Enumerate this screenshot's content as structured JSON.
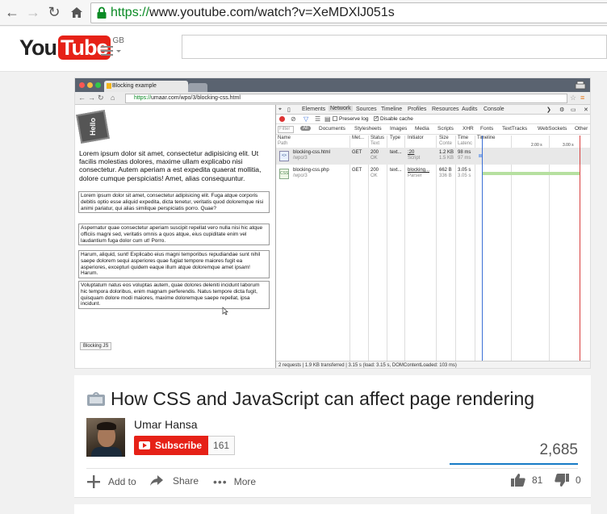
{
  "browser": {
    "url_https": "https://",
    "url_rest": "www.youtube.com/watch?v=XeMDXlJ051s"
  },
  "youtube": {
    "logo_you": "You",
    "logo_tube": "Tube",
    "logo_region": "GB"
  },
  "player": {
    "inner_tab_title": "Blocking example",
    "inner_url_https": "https://",
    "inner_url_rest": "umaar.com/wpo/3/blocking-css.html",
    "hello": "Hello",
    "big_paragraph": "Lorem ipsum dolor sit amet, consectetur adipisicing elit. Ut facilis molestias dolores, maxime ullam explicabo nisi consectetur. Autem aperiam a est expedita quaerat mollitia, dolore cumque perspiciatis! Amet, alias consequuntur.",
    "boxes": [
      "Lorem ipsum dolor sit amet, consectetur adipisicing elit. Fuga atque corporis debitis optio esse aliquid expedita, dicta tenetur, veritatis quod doloremque nisi animi pariatur, qui alias similique perspiciatis porro. Quae?",
      "Aspernatur quae consectetur aperiam suscipit repellat vero nulla nisi hic atque officiis magni sed, veritatis omnis a quos atque, eius cupiditate enim vel laudantium fuga dolor cum ut! Porro.",
      "Harum, aliquid, sunt! Explicabo eius magni temporibus repudiandae sunt nihil saepe dolorem sequi asperiores quae fugiat tempore maiores fugit ea asperiores, excepturi quidem eaque illum atque doloremque amet ipsam! Harum.",
      "Voluptatum natus eos voluptas autem, quae dolores deleniti incidunt laborum hic tempora doloribus, enim magnam perferendis. Natus tempore dicta fugit, quisquam dolore modi maiores, maxime doloremque saepe repellat, ipsa incidunt."
    ],
    "blocking_button": "Blocking JS",
    "devtools": {
      "tabs": [
        "Elements",
        "Network",
        "Sources",
        "Timeline",
        "Profiles",
        "Resources",
        "Audits",
        "Console"
      ],
      "preserve_log": "Preserve log",
      "disable_cache": "Disable cache",
      "filter_placeholder": "Filter",
      "filter_all": "All",
      "filter_types": [
        "Documents",
        "Stylesheets",
        "Images",
        "Media",
        "Scripts",
        "XHR",
        "Fonts",
        "TextTracks",
        "WebSockets",
        "Other"
      ],
      "headers": {
        "name": "Name",
        "name_sub": "Path",
        "method": "Met...",
        "status": "Status",
        "status_sub": "Text",
        "type": "Type",
        "initiator": "Initiator",
        "size": "Size",
        "size_sub": "Conte",
        "time": "Time",
        "time_sub": "Latenc",
        "timeline": "Timeline"
      },
      "timeline_marks": [
        "2.00 s",
        "3.00 s"
      ],
      "rows": [
        {
          "icon": "<>",
          "name": "blocking-css.html",
          "path": "/wpo/3",
          "method": "GET",
          "status": "200",
          "status_text": "OK",
          "type": "text...",
          "initiator": ":20",
          "initiator_sub": "Script",
          "size": "1.2 KB",
          "size_sub": "1.5 KB",
          "time": "98 ms",
          "time_sub": "97 ms"
        },
        {
          "icon": "CSS",
          "name": "blocking-css.php",
          "path": "/wpo/3",
          "method": "GET",
          "status": "200",
          "status_text": "OK",
          "type": "text...",
          "initiator": "blocking...",
          "initiator_sub": "Parser",
          "size": "662 B",
          "size_sub": "336 B",
          "time": "3.05 s",
          "time_sub": "3.05 s"
        }
      ],
      "status_bar": "2 requests | 1.9 KB transferred | 3.15 s (load: 3.15 s, DOMContentLoaded: 103 ms)"
    }
  },
  "video": {
    "title": "How CSS and JavaScript can affect page rendering",
    "channel": "Umar Hansa",
    "subscribe_label": "Subscribe",
    "subscriber_count": "161",
    "views": "2,685",
    "actions": {
      "add_to": "Add to",
      "share": "Share",
      "more": "More"
    },
    "likes": "81",
    "dislikes": "0"
  },
  "colors": {
    "youtube_red": "#e62117",
    "https_green": "#0a8a24",
    "view_bar_blue": "#167ac6"
  }
}
